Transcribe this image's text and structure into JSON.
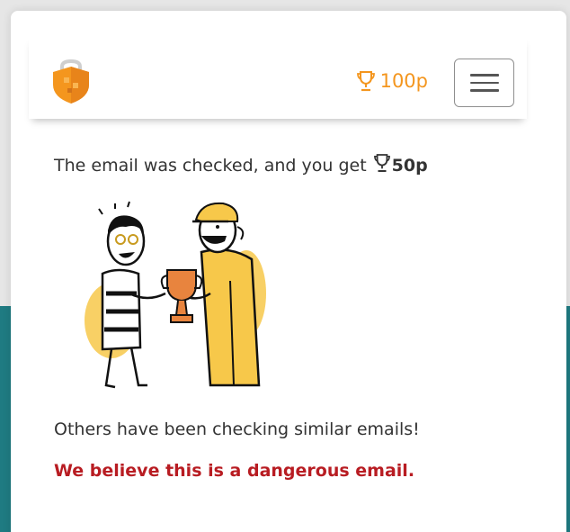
{
  "header": {
    "logo_icon": "shield-lock-logo-icon",
    "points_icon": "trophy-icon",
    "points": "100p",
    "menu_icon": "hamburger-menu-icon"
  },
  "result": {
    "message": "The email was checked, and you get",
    "reward_icon": "trophy-icon",
    "reward": "50p"
  },
  "illustration": {
    "name": "two-people-trophy-illustration"
  },
  "community": {
    "message": "Others have been checking similar emails!"
  },
  "verdict": {
    "message": "We believe this is a dangerous email."
  },
  "colors": {
    "accent": "#f4961e",
    "danger": "#b81c22",
    "teal": "#1f7b82",
    "illustration_yellow": "#f7c84a"
  }
}
